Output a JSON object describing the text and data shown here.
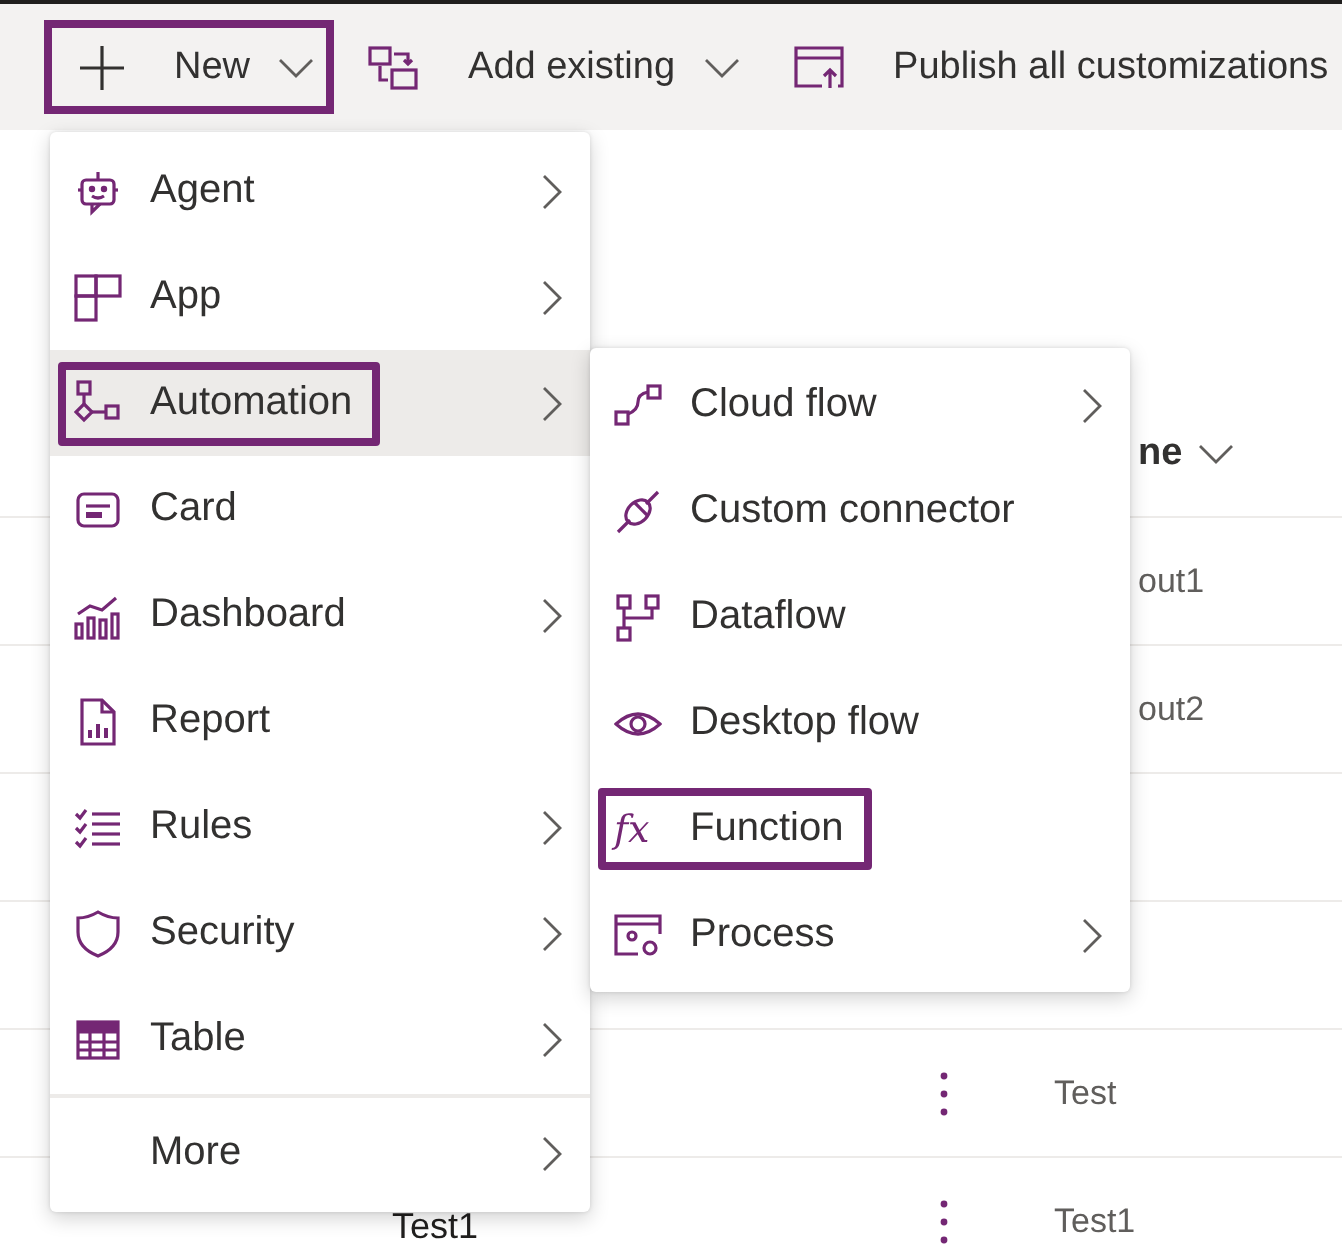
{
  "toolbar": [
    {
      "kind": "new",
      "label": "New",
      "highlighted": true
    },
    {
      "kind": "add",
      "label": "Add existing",
      "highlighted": false
    },
    {
      "kind": "publish",
      "label": "Publish all customizations",
      "highlighted": false
    }
  ],
  "table": {
    "header": "ne",
    "rows": [
      {
        "column_3": "out1"
      },
      {
        "column_3": "out2"
      },
      {},
      {},
      {
        "more": true,
        "column_3": "Test"
      },
      {
        "column_1": "Test1",
        "more": true,
        "column_3": "Test1"
      }
    ]
  },
  "menu": {
    "items": [
      {
        "label": "Agent",
        "submenu": true,
        "selected": false,
        "highlighted": false
      },
      {
        "label": "App",
        "submenu": true,
        "selected": false,
        "highlighted": false
      },
      {
        "label": "Automation",
        "submenu": true,
        "selected": true,
        "highlighted": true
      },
      {
        "label": "Card",
        "submenu": false,
        "selected": false,
        "highlighted": false
      },
      {
        "label": "Dashboard",
        "submenu": true,
        "selected": false,
        "highlighted": false
      },
      {
        "label": "Report",
        "submenu": false,
        "selected": false,
        "highlighted": false
      },
      {
        "label": "Rules",
        "submenu": true,
        "selected": false,
        "highlighted": false
      },
      {
        "label": "Security",
        "submenu": true,
        "selected": false,
        "highlighted": false
      },
      {
        "label": "Table",
        "submenu": true,
        "selected": false,
        "highlighted": false
      },
      {
        "label": "More",
        "submenu": true,
        "selected": false,
        "highlighted": false,
        "divider_before": true
      }
    ]
  },
  "submenu": {
    "items": [
      {
        "label": "Cloud flow",
        "submenu": true,
        "selected": false,
        "highlighted": false
      },
      {
        "label": "Custom connector",
        "submenu": false,
        "selected": false,
        "highlighted": false
      },
      {
        "label": "Dataflow",
        "submenu": false,
        "selected": false,
        "highlighted": false
      },
      {
        "label": "Desktop flow",
        "submenu": false,
        "selected": false,
        "highlighted": false
      },
      {
        "label": "Function",
        "submenu": false,
        "selected": false,
        "highlighted": true,
        "icon_text": "fx"
      },
      {
        "label": "Process",
        "submenu": true,
        "selected": false,
        "highlighted": false
      }
    ]
  }
}
